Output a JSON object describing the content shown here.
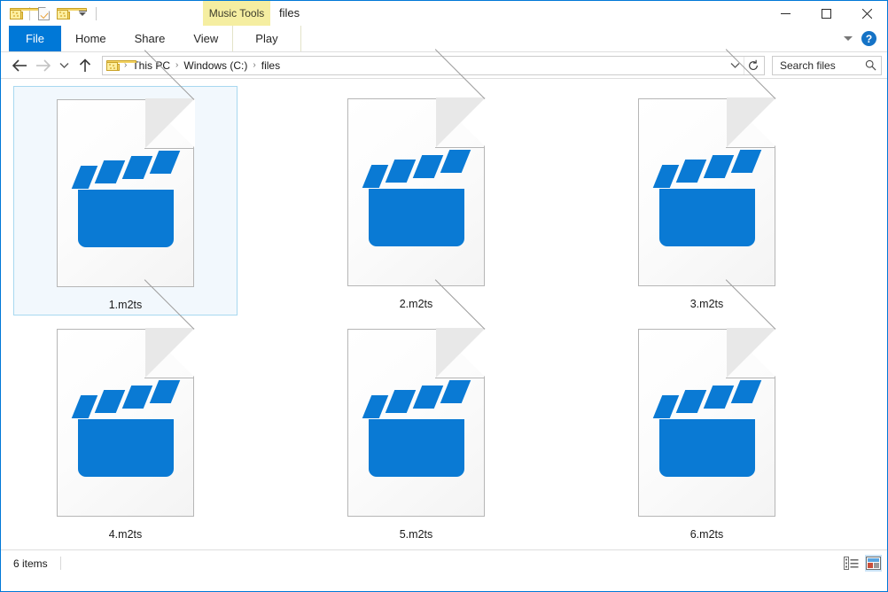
{
  "window": {
    "title": "files",
    "accent_color": "#0078d7",
    "contextual_tool": "Music Tools",
    "contextual_tool_color": "#f5eea1"
  },
  "quick_access": {
    "items": [
      {
        "name": "folder-icon",
        "label": "Folder"
      },
      {
        "name": "properties-icon",
        "label": "Properties"
      },
      {
        "name": "new-folder-icon",
        "label": "New folder"
      },
      {
        "name": "customize-caret-icon",
        "label": "Customize Quick Access Toolbar"
      }
    ]
  },
  "window_controls": {
    "minimize": "Minimize",
    "maximize": "Maximize",
    "close": "Close"
  },
  "ribbon": {
    "tabs": [
      {
        "label": "File",
        "active": true
      },
      {
        "label": "Home",
        "active": false
      },
      {
        "label": "Share",
        "active": false
      },
      {
        "label": "View",
        "active": false
      },
      {
        "label": "Play",
        "active": false,
        "contextual": true
      }
    ],
    "expand_label": "Expand the Ribbon",
    "help_label": "?"
  },
  "address": {
    "back_label": "Back",
    "forward_label": "Forward",
    "recent_label": "Recent locations",
    "up_label": "Up",
    "breadcrumbs": [
      {
        "label": "This PC"
      },
      {
        "label": "Windows (C:)"
      },
      {
        "label": "files"
      }
    ],
    "separator": "›",
    "dropdown_label": "Previous locations",
    "refresh_label": "Refresh"
  },
  "search": {
    "placeholder": "Search files",
    "icon": "search-icon"
  },
  "files": [
    {
      "name": "1.m2ts",
      "type": "video",
      "selected": true
    },
    {
      "name": "2.m2ts",
      "type": "video",
      "selected": false
    },
    {
      "name": "3.m2ts",
      "type": "video",
      "selected": false
    },
    {
      "name": "4.m2ts",
      "type": "video",
      "selected": false
    },
    {
      "name": "5.m2ts",
      "type": "video",
      "selected": false
    },
    {
      "name": "6.m2ts",
      "type": "video",
      "selected": false
    }
  ],
  "status": {
    "item_count": "6 items",
    "view_details_label": "Details view",
    "view_large_icons_label": "Large icons view",
    "active_view": "large-icons"
  },
  "icon_colors": {
    "clapperboard_blue": "#0a7ad4",
    "page_white": "#ffffff",
    "page_border": "#b6b6b6",
    "fold_gray": "#e8e8e8",
    "folder_yellow": "#fdeea0",
    "selection_fill": "#f2f8fd",
    "selection_border": "#a8d8f0"
  }
}
